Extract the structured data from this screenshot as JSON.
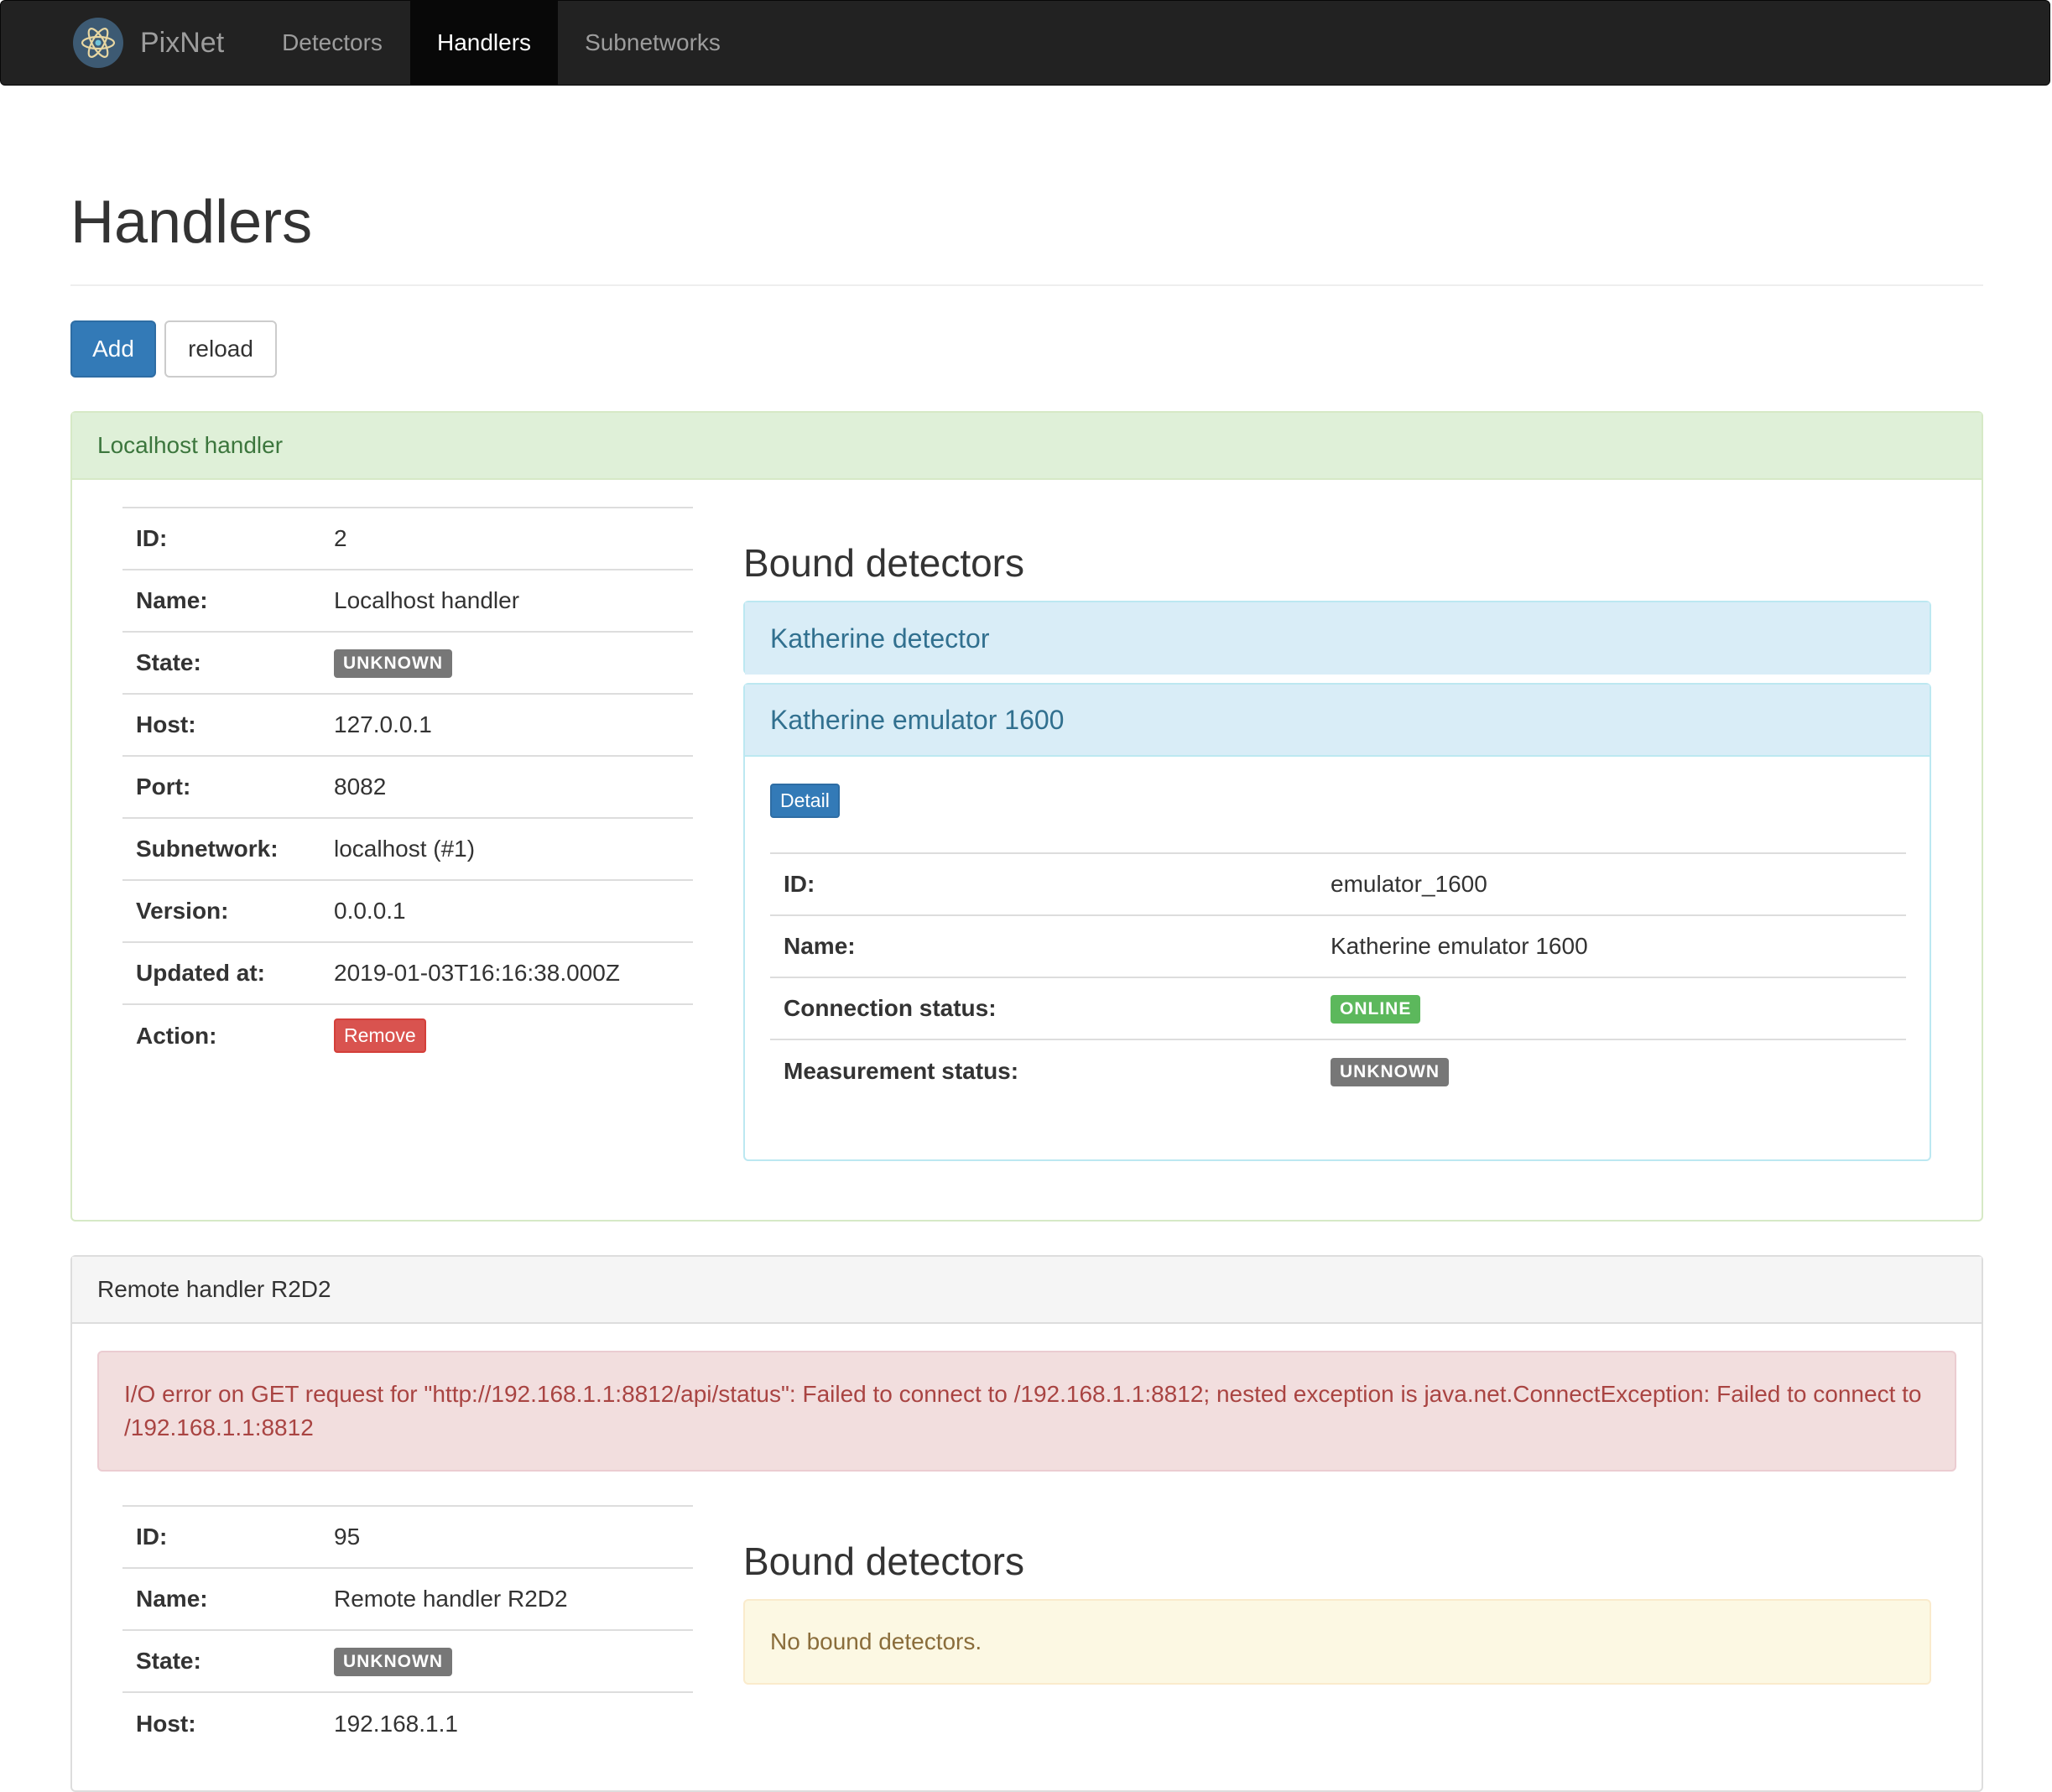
{
  "nav": {
    "brand": "PixNet",
    "items": [
      {
        "label": "Detectors",
        "active": false
      },
      {
        "label": "Handlers",
        "active": true
      },
      {
        "label": "Subnetworks",
        "active": false
      }
    ]
  },
  "page": {
    "title": "Handlers",
    "add_label": "Add",
    "reload_label": "reload"
  },
  "handlers": [
    {
      "heading": "Localhost handler",
      "keys": {
        "id": "ID:",
        "name": "Name:",
        "state": "State:",
        "host": "Host:",
        "port": "Port:",
        "subnetwork": "Subnetwork:",
        "version": "Version:",
        "updated_at": "Updated at:",
        "action": "Action:"
      },
      "values": {
        "id": "2",
        "name": "Localhost handler",
        "state": "UNKNOWN",
        "host": "127.0.0.1",
        "port": "8082",
        "subnetwork": "localhost (#1)",
        "version": "0.0.0.1",
        "updated_at": "2019-01-03T16:16:38.000Z",
        "action": "Remove"
      },
      "bound_title": "Bound detectors",
      "detectors": [
        {
          "heading": "Katherine detector"
        },
        {
          "heading": "Katherine emulator 1600",
          "detail_label": "Detail",
          "keys": {
            "id": "ID:",
            "name": "Name:",
            "connection": "Connection status:",
            "measurement": "Measurement status:"
          },
          "values": {
            "id": "emulator_1600",
            "name": "Katherine emulator 1600",
            "connection": "ONLINE",
            "measurement": "UNKNOWN"
          }
        }
      ]
    },
    {
      "heading": "Remote handler R2D2",
      "error": "I/O error on GET request for \"http://192.168.1.1:8812/api/status\": Failed to connect to /192.168.1.1:8812; nested exception is java.net.ConnectException: Failed to connect to /192.168.1.1:8812",
      "keys": {
        "id": "ID:",
        "name": "Name:",
        "state": "State:",
        "host": "Host:"
      },
      "values": {
        "id": "95",
        "name": "Remote handler R2D2",
        "state": "UNKNOWN",
        "host": "192.168.1.1"
      },
      "bound_title": "Bound detectors",
      "no_detectors": "No bound detectors."
    }
  ],
  "colors": {
    "navbar_bg": "#222222",
    "primary": "#337ab7",
    "success": "#5cb85c",
    "danger": "#d9534f",
    "label_default": "#777777"
  }
}
